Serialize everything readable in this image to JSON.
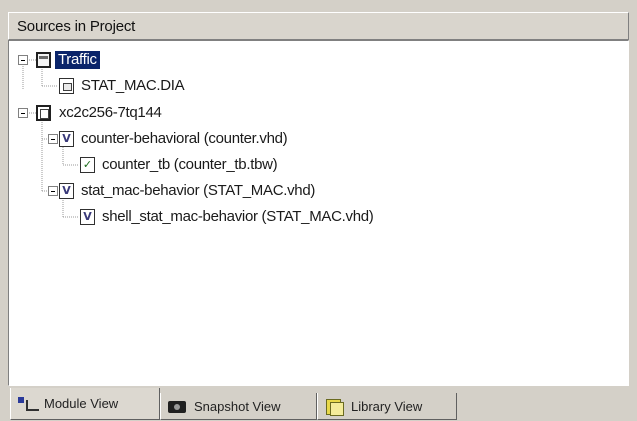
{
  "panel": {
    "title": "Sources in Project"
  },
  "tree": {
    "items": [
      {
        "label": "Traffic",
        "icon": "folder-icon",
        "selected": true
      },
      {
        "label": "STAT_MAC.DIA",
        "icon": "diagram-file-icon"
      },
      {
        "label": "xc2c256-7tq144",
        "icon": "device-chip-icon"
      },
      {
        "label": "counter-behavioral (counter.vhd)",
        "icon": "vhdl-file-icon"
      },
      {
        "label": "counter_tb (counter_tb.tbw)",
        "icon": "testbench-file-icon"
      },
      {
        "label": "stat_mac-behavior (STAT_MAC.vhd)",
        "icon": "vhdl-file-icon"
      },
      {
        "label": "shell_stat_mac-behavior (STAT_MAC.vhd)",
        "icon": "vhdl-file-icon"
      }
    ]
  },
  "tabs": [
    {
      "label": "Module View",
      "icon": "module-view-icon",
      "active": true
    },
    {
      "label": "Snapshot View",
      "icon": "camera-icon",
      "active": false
    },
    {
      "label": "Library View",
      "icon": "library-books-icon",
      "active": false
    }
  ],
  "colors": {
    "selection": "#0a246a",
    "panel_bg": "#d4d0c8",
    "tree_bg": "#ffffff"
  }
}
